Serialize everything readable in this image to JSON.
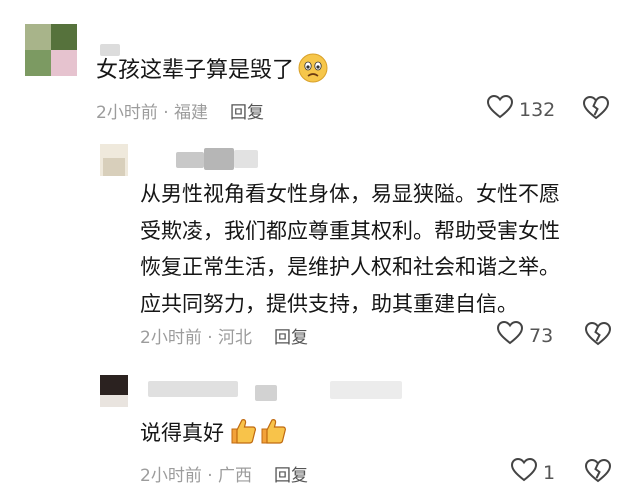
{
  "comments": [
    {
      "text": "女孩这辈子算是毁了",
      "emoji": "worried-face",
      "time": "2小时前",
      "location": "福建",
      "reply_label": "回复",
      "likes": "132"
    },
    {
      "lines": [
        "从男性视角看女性身体，易显狭隘。女性不愿",
        "受欺凌，我们都应尊重其权利。帮助受害女性",
        "恢复正常生活，是维护人权和社会和谐之举。",
        "应共同努力，提供支持，助其重建自信。"
      ],
      "time": "2小时前",
      "location": "河北",
      "reply_label": "回复",
      "likes": "73"
    },
    {
      "text": "说得真好",
      "emoji": "thumbs-up x2",
      "time": "2小时前",
      "location": "广西",
      "reply_label": "回复",
      "likes": "1"
    }
  ],
  "colors": {
    "meta": "#9c9c9c",
    "text": "#161616",
    "icon": "#555555"
  }
}
